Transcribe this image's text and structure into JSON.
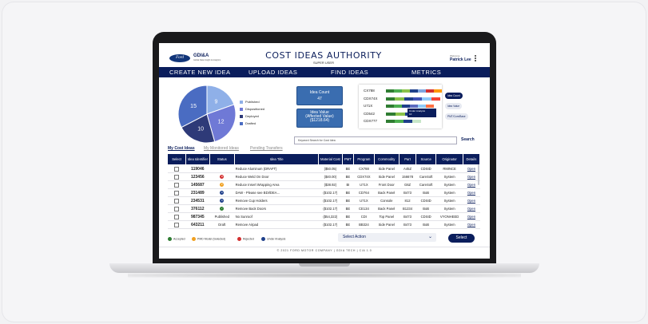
{
  "app": {
    "brand": "GDI&A",
    "brand_sub": "Global Data Insight & Analytics",
    "logo_text": "Ford",
    "title": "COST IDEAS AUTHORITY",
    "subtitle": "SUPER USER",
    "welcome": "Welcome",
    "user": "Patrick Lee"
  },
  "nav": [
    "CREATE NEW IDEA",
    "UPLOAD IDEAS",
    "FIND IDEAS",
    "METRICS"
  ],
  "pie": {
    "slices": [
      {
        "label": "9",
        "value": 9,
        "color": "#8fb0e8"
      },
      {
        "label": "12",
        "value": 12,
        "color": "#6f79d6"
      },
      {
        "label": "10",
        "value": 10,
        "color": "#2e3a78"
      },
      {
        "label": "15",
        "value": 15,
        "color": "#4a6cc2"
      }
    ],
    "legend": [
      {
        "label": "Published",
        "color": "#8fb0e8"
      },
      {
        "label": "Dispositioned",
        "color": "#6f79d6"
      },
      {
        "label": "Deployed",
        "color": "#2e3a78"
      },
      {
        "label": "Drafted",
        "color": "#4a6cc2"
      }
    ]
  },
  "counts": {
    "idea_count_label": "Idea Count",
    "idea_count": "47",
    "idea_value_label": "Idea Value",
    "idea_value_sub": "(Affected Value)",
    "idea_value": "($1218.64)"
  },
  "program_bars": [
    {
      "label": "CX788",
      "segments": [
        "#2f7d32",
        "#4caf50",
        "#8bc34a",
        "#1e3f8a",
        "#7fa6e0",
        "#d32f2f",
        "#ff9800"
      ]
    },
    {
      "label": "CDX74X",
      "segments": [
        "#2f7d32",
        "#8bc34a",
        "#1e3f8a",
        "#3f51b5",
        "#90caf9",
        "#f44336"
      ]
    },
    {
      "label": "U71X",
      "segments": [
        "#2f7d32",
        "#4caf50",
        "#1e3f8a",
        "#5c6bc0",
        "#90caf9",
        "#ff7043"
      ]
    },
    {
      "label": "CD542",
      "segments": [
        "#2f7d32",
        "#8bc34a",
        "#1e3f8a",
        "#3f51b5"
      ]
    },
    {
      "label": "CDX777",
      "segments": [
        "#2f7d32",
        "#4caf50",
        "#1e3f8a",
        "#c8e6c9"
      ]
    }
  ],
  "tooltip": {
    "line1": "Under Analysis",
    "line2": "10"
  },
  "pills": [
    "Idea Count",
    "Idea Value",
    "PMT/Com/Base"
  ],
  "search": {
    "placeholder": "Keyword Search for Cost Idea",
    "button": "Search"
  },
  "tabs": [
    "My Cost Ideas",
    "My Monitored Ideas",
    "Pending Transfers"
  ],
  "table": {
    "headers": [
      "Select",
      "Idea Identifier",
      "Status",
      "Idea Title",
      "Material Cost",
      "PMT",
      "Program",
      "Commodity",
      "Part",
      "Source",
      "Originator",
      "Details"
    ],
    "rows": [
      {
        "id": "119046",
        "status": "",
        "status_color": "",
        "title": "Reduce Aluminum (DRAFT)",
        "cost": "($50.05)",
        "pmt": "BE",
        "program": "CX788",
        "commodity": "Side Panel",
        "part": "A45Z",
        "source": "CDSID",
        "originator": "RMINCE",
        "details": "Open"
      },
      {
        "id": "123456",
        "status": "R",
        "status_color": "#d32f2f",
        "title": "Reduce Weld On Door",
        "cost": "($40.00)",
        "pmt": "BE",
        "program": "CDX74X",
        "commodity": "Side Panel",
        "part": "156678",
        "source": "CareSoft",
        "originator": "System",
        "details": "Open"
      },
      {
        "id": "145687",
        "status": "P",
        "status_color": "#f0a020",
        "title": "Reduce Insert Wrapping Area",
        "cost": "($38.92)",
        "pmt": "BI",
        "program": "U71X",
        "commodity": "Front Door",
        "part": "G6Z",
        "source": "CareSoft",
        "originator": "System",
        "details": "Open"
      },
      {
        "id": "231489",
        "status": "A",
        "status_color": "#1e3f8a",
        "title": "DAW - Please see BDI/DEA...",
        "cost": "($102.17)",
        "pmt": "BE",
        "program": "CD764",
        "commodity": "Back Panel",
        "part": "B473",
        "source": "BoB",
        "originator": "System",
        "details": "Open"
      },
      {
        "id": "234531",
        "status": "A",
        "status_color": "#1e3f8a",
        "title": "Remove Cup Holders",
        "cost": "($102.17)",
        "pmt": "BE",
        "program": "U71X",
        "commodity": "Console",
        "part": "812",
        "source": "CDSID",
        "originator": "System",
        "details": "Open"
      },
      {
        "id": "376112",
        "status": "✓",
        "status_color": "#2e7d32",
        "title": "Remove Back Doors",
        "cost": "($102.17)",
        "pmt": "BE",
        "program": "CE134",
        "commodity": "Back Panel",
        "part": "B1234",
        "source": "BoB",
        "originator": "System",
        "details": "Open"
      },
      {
        "id": "987345",
        "status_text": "Published",
        "title": "No Sunroof",
        "cost": "($54,322)",
        "pmt": "BE",
        "program": "CDI",
        "commodity": "Top Panel",
        "part": "B473",
        "source": "CDSID",
        "originator": "VYONHEED",
        "details": "Open"
      },
      {
        "id": "643211",
        "status_text": "Draft",
        "title": "Remove Airpad",
        "cost": "($102.17)",
        "pmt": "BE",
        "program": "BB324",
        "commodity": "Side Panel",
        "part": "B473",
        "source": "BoB",
        "originator": "System",
        "details": "Open"
      }
    ]
  },
  "status_key": [
    {
      "label": "Accepted",
      "color": "#2e7d32"
    },
    {
      "label": "PMD Model (Selected)",
      "color": "#f0a020"
    },
    {
      "label": "Rejected",
      "color": "#d32f2f"
    },
    {
      "label": "Under Analysis",
      "color": "#1e3f8a"
    }
  ],
  "actions": {
    "select_action": "Select Action",
    "select_button": "Select"
  },
  "footer": "© 2021 FORD MOTOR COMPANY | GDIA TECH | CIA 1.0"
}
